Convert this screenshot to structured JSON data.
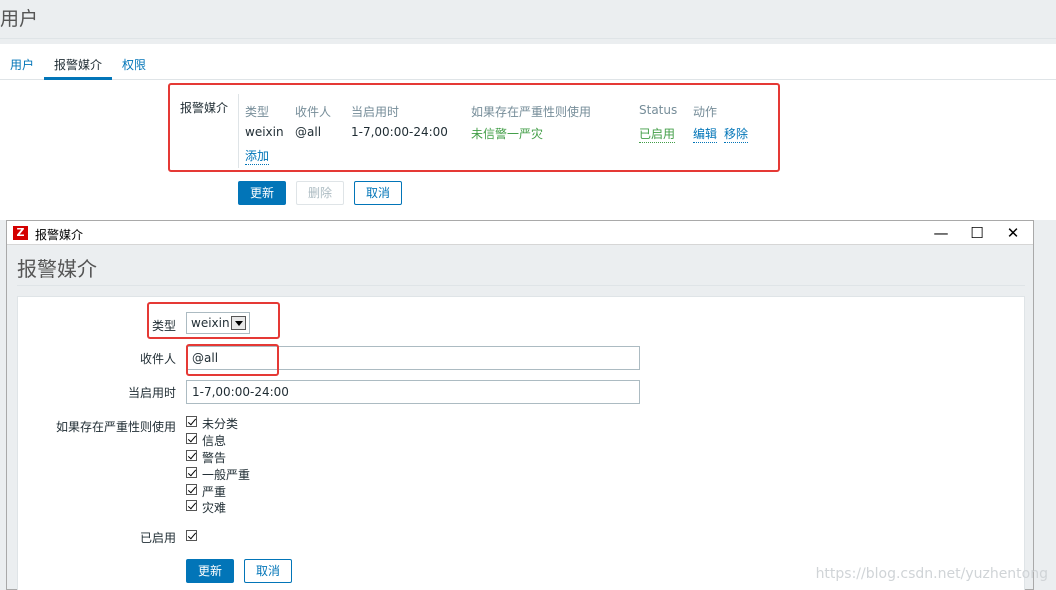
{
  "page": {
    "title": "用户",
    "tabs": [
      {
        "label": "用户"
      },
      {
        "label": "报警媒介"
      },
      {
        "label": "权限"
      }
    ]
  },
  "media_section": {
    "label": "报警媒介",
    "headers": {
      "type": "类型",
      "recipient": "收件人",
      "when_active": "当启用时",
      "severity": "如果存在严重性则使用",
      "status": "Status",
      "action": "动作"
    },
    "row": {
      "type": "weixin",
      "recipient": "@all",
      "when_active": "1-7,00:00-24:00",
      "severity": "未信警一严灾",
      "status": "已启用",
      "edit": "编辑",
      "remove": "移除"
    },
    "add_link": "添加"
  },
  "buttons": {
    "update": "更新",
    "delete": "删除",
    "cancel": "取消"
  },
  "popup": {
    "window_title": "报警媒介",
    "heading": "报警媒介",
    "form": {
      "type_label": "类型",
      "type_value": "weixin",
      "recipient_label": "收件人",
      "recipient_value": "@all",
      "when_active_label": "当启用时",
      "when_active_value": "1-7,00:00-24:00",
      "severity_label": "如果存在严重性则使用",
      "severities": [
        {
          "label": "未分类",
          "checked": true
        },
        {
          "label": "信息",
          "checked": true
        },
        {
          "label": "警告",
          "checked": true
        },
        {
          "label": "一般严重",
          "checked": true
        },
        {
          "label": "严重",
          "checked": true
        },
        {
          "label": "灾难",
          "checked": true
        }
      ],
      "enabled_label": "已启用",
      "enabled": true,
      "update_button": "更新",
      "cancel_button": "取消"
    }
  },
  "watermark": "https://blog.csdn.net/yuzhentong",
  "colors": {
    "accent": "#0275b8",
    "highlight_box": "#e53935",
    "enabled_green": "#429e47"
  }
}
